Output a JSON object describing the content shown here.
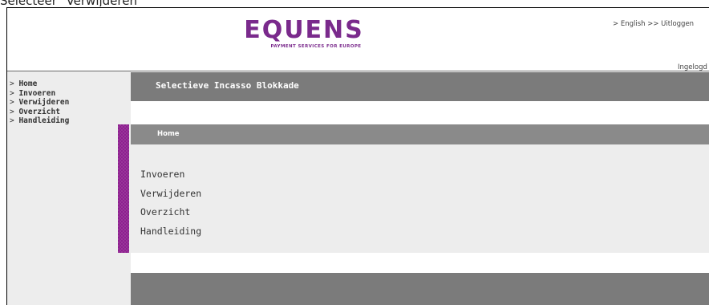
{
  "caption": "Selecteer \"Verwijderen\"",
  "header": {
    "logo_text": "EQUENS",
    "logo_tagline": "PAYMENT SERVICES FOR EUROPE",
    "lang_link": "> English",
    "logout_link": ">> Uitloggen",
    "login_status": "Ingelogd"
  },
  "sidebar": {
    "items": [
      {
        "prefix": "> ",
        "label": "Home"
      },
      {
        "prefix": "> ",
        "label": "Invoeren"
      },
      {
        "prefix": "> ",
        "label": "Verwijderen"
      },
      {
        "prefix": "> ",
        "label": "Overzicht"
      },
      {
        "prefix": "> ",
        "label": "Handleiding"
      }
    ]
  },
  "main": {
    "title": "Selectieve Incasso Blokkade",
    "section_title": "Home",
    "links": [
      "Invoeren",
      "Verwijderen",
      "Overzicht",
      "Handleiding"
    ]
  },
  "colors": {
    "brand_purple": "#7a2a8c",
    "accent_strip": "#8d1f8f",
    "bar_gray": "#7b7b7b",
    "panel_gray": "#ededed"
  }
}
